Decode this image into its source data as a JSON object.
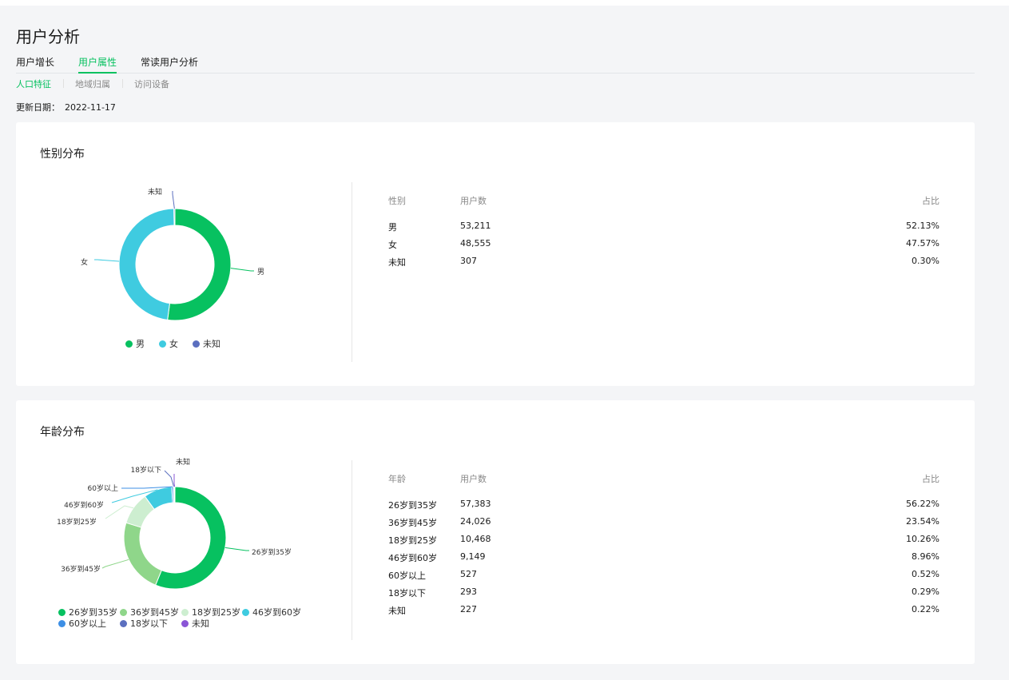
{
  "page": {
    "title": "用户分析"
  },
  "tabs": [
    {
      "label": "用户增长",
      "active": false
    },
    {
      "label": "用户属性",
      "active": true
    },
    {
      "label": "常读用户分析",
      "active": false
    }
  ],
  "subtabs": [
    {
      "label": "人口特征",
      "active": true
    },
    {
      "label": "地域归属",
      "active": false
    },
    {
      "label": "访问设备",
      "active": false
    }
  ],
  "update": {
    "label": "更新日期：",
    "date": "2022-11-17"
  },
  "colors": {
    "accent": "#07c160"
  },
  "gender": {
    "title": "性别分布",
    "table": {
      "headers": [
        "性别",
        "用户数",
        "占比"
      ],
      "rows": [
        {
          "name": "男",
          "count": "53,211",
          "pct": "52.13%"
        },
        {
          "name": "女",
          "count": "48,555",
          "pct": "47.57%"
        },
        {
          "name": "未知",
          "count": "307",
          "pct": "0.30%"
        }
      ]
    }
  },
  "age": {
    "title": "年龄分布",
    "table": {
      "headers": [
        "年龄",
        "用户数",
        "占比"
      ],
      "rows": [
        {
          "name": "26岁到35岁",
          "count": "57,383",
          "pct": "56.22%"
        },
        {
          "name": "36岁到45岁",
          "count": "24,026",
          "pct": "23.54%"
        },
        {
          "name": "18岁到25岁",
          "count": "10,468",
          "pct": "10.26%"
        },
        {
          "name": "46岁到60岁",
          "count": "9,149",
          "pct": "8.96%"
        },
        {
          "name": "60岁以上",
          "count": "527",
          "pct": "0.52%"
        },
        {
          "name": "18岁以下",
          "count": "293",
          "pct": "0.29%"
        },
        {
          "name": "未知",
          "count": "227",
          "pct": "0.22%"
        }
      ]
    }
  },
  "chart_data": [
    {
      "type": "pie",
      "categories": [
        "男",
        "女",
        "未知"
      ],
      "values": [
        52.13,
        47.57,
        0.3
      ],
      "colors": [
        "#07c160",
        "#3fcbe0",
        "#5b6fbf"
      ],
      "legend": "bottom"
    },
    {
      "type": "pie",
      "categories": [
        "26岁到35岁",
        "36岁到45岁",
        "18岁到25岁",
        "46岁到60岁",
        "60岁以上",
        "18岁以下",
        "未知"
      ],
      "values": [
        56.22,
        23.54,
        10.26,
        8.96,
        0.52,
        0.29,
        0.22
      ],
      "colors": [
        "#07c160",
        "#8fd68a",
        "#cdeed0",
        "#3fcbe0",
        "#3d8fe5",
        "#5b6fbf",
        "#8a55d6"
      ],
      "legend": "bottom"
    }
  ]
}
